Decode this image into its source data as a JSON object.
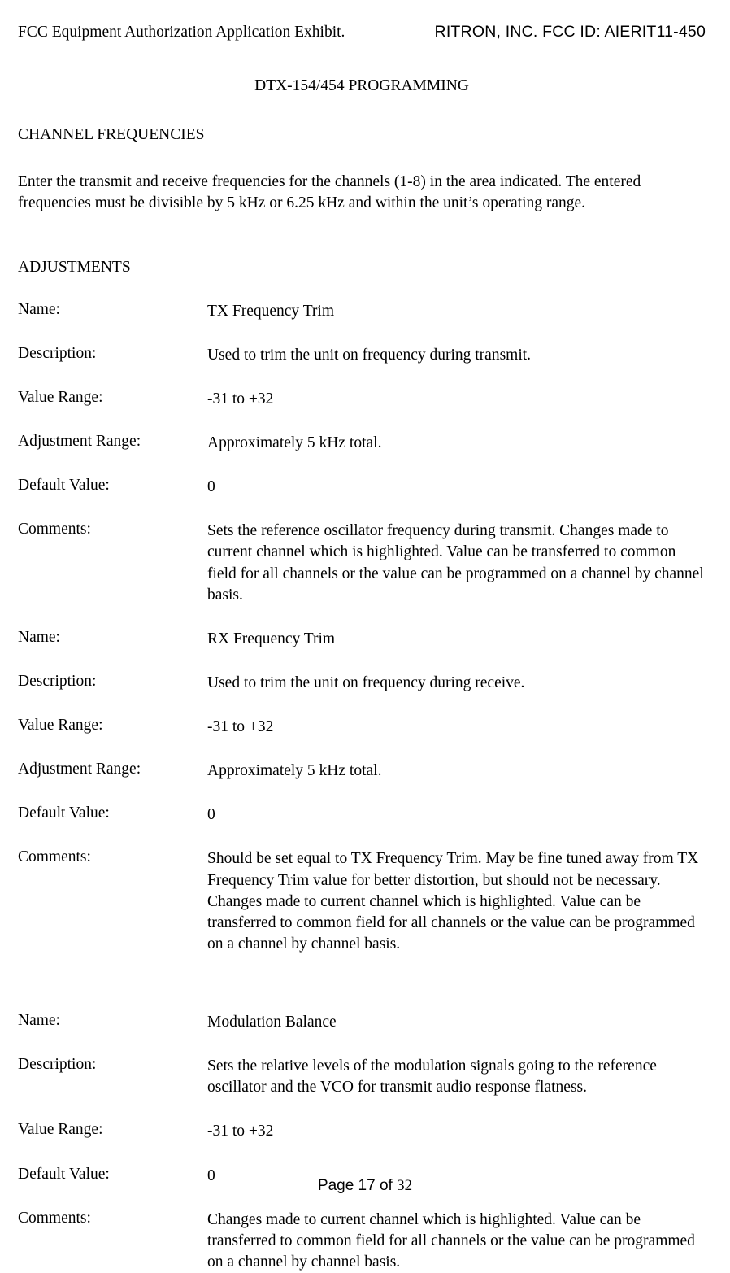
{
  "header": {
    "left": "FCC Equipment Authorization Application Exhibit.",
    "right": "RITRON, INC.  FCC ID:  AIERIT11-450"
  },
  "title": "DTX-154/454 PROGRAMMING",
  "section_channel_heading": "CHANNEL FREQUENCIES",
  "channel_intro": "Enter the transmit and receive frequencies for the channels (1-8) in the area indicated.  The entered frequencies must be divisible by 5 kHz or 6.25 kHz and within the unit’s operating range.",
  "section_adjustments_heading": "ADJUSTMENTS",
  "labels": {
    "name": "Name:",
    "description": "Description:",
    "value_range": "Value Range:",
    "adjustment_range": "Adjustment Range:",
    "default_value": "Default Value:",
    "comments": "Comments:"
  },
  "adjustments": [
    {
      "name": "TX Frequency Trim",
      "description": "Used to trim the unit on frequency during transmit.",
      "value_range": "-31 to +32",
      "adjustment_range": "Approximately 5 kHz total.",
      "default_value": "0",
      "comments": "Sets the reference oscillator frequency during transmit. Changes made to current channel which is highlighted.  Value can be transferred to common field for all channels or the value can be programmed on a channel by channel basis."
    },
    {
      "name": "RX Frequency Trim",
      "description": "Used to trim the unit on frequency during receive.",
      "value_range": "-31 to +32",
      "adjustment_range": "Approximately 5 kHz total.",
      "default_value": "0",
      "comments": "Should be set equal to TX Frequency Trim.  May be fine tuned away from TX Frequency Trim value for better distortion, but should not be necessary.  Changes made to current channel which is highlighted.  Value can be transferred to common field for all channels or the value can be programmed on a channel by channel basis."
    },
    {
      "name": "Modulation Balance",
      "description": "Sets the relative levels of the modulation signals going to the reference oscillator and the VCO for transmit audio response flatness.",
      "value_range": "-31 to +32",
      "default_value": "0",
      "comments": "Changes made to current channel which is highlighted.  Value can be transferred to common field for all channels or the value can be programmed on a channel by channel basis."
    }
  ],
  "footer": {
    "prefix": "Page 17 of ",
    "total": "32"
  }
}
